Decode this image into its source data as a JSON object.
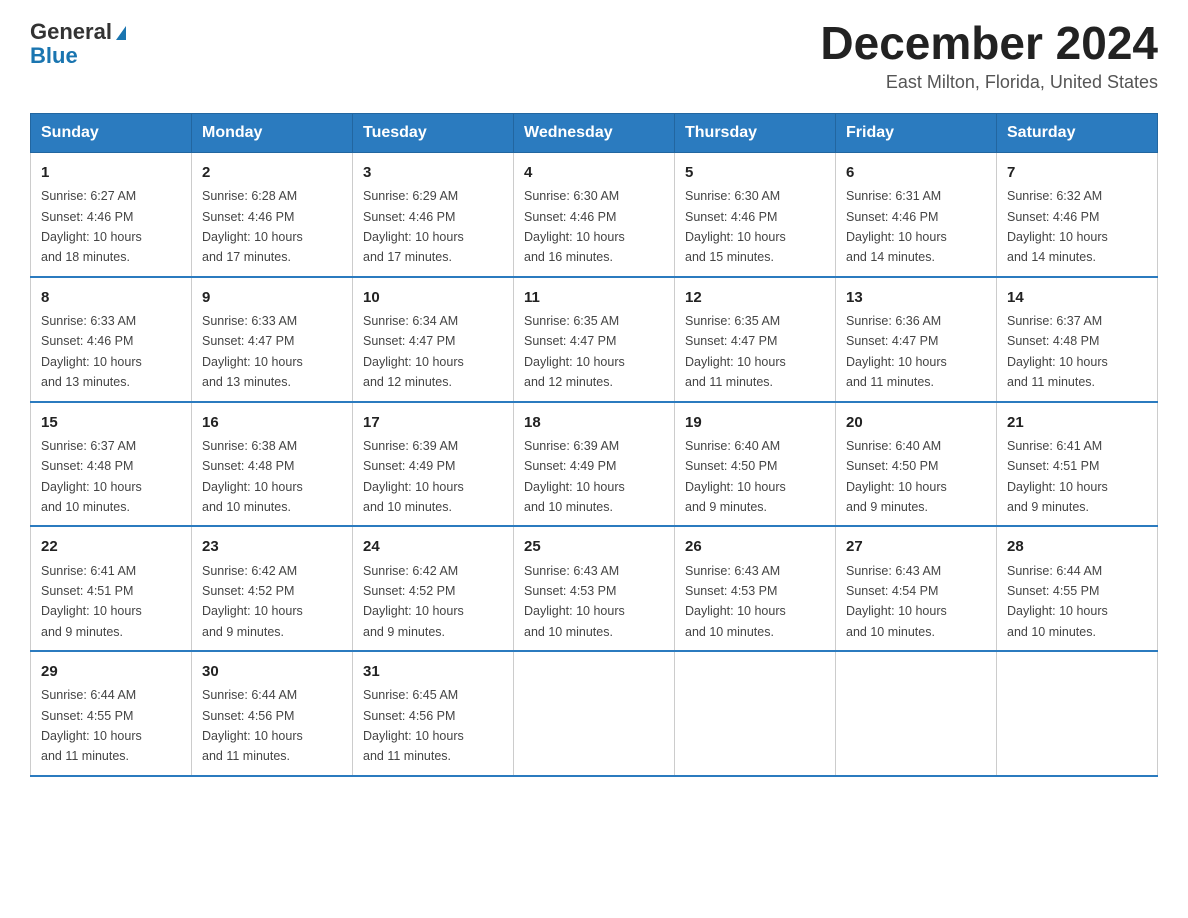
{
  "header": {
    "logo_general": "General",
    "logo_blue": "Blue",
    "month_title": "December 2024",
    "location": "East Milton, Florida, United States"
  },
  "days_of_week": [
    "Sunday",
    "Monday",
    "Tuesday",
    "Wednesday",
    "Thursday",
    "Friday",
    "Saturday"
  ],
  "weeks": [
    [
      {
        "day": "1",
        "sunrise": "6:27 AM",
        "sunset": "4:46 PM",
        "daylight": "10 hours and 18 minutes."
      },
      {
        "day": "2",
        "sunrise": "6:28 AM",
        "sunset": "4:46 PM",
        "daylight": "10 hours and 17 minutes."
      },
      {
        "day": "3",
        "sunrise": "6:29 AM",
        "sunset": "4:46 PM",
        "daylight": "10 hours and 17 minutes."
      },
      {
        "day": "4",
        "sunrise": "6:30 AM",
        "sunset": "4:46 PM",
        "daylight": "10 hours and 16 minutes."
      },
      {
        "day": "5",
        "sunrise": "6:30 AM",
        "sunset": "4:46 PM",
        "daylight": "10 hours and 15 minutes."
      },
      {
        "day": "6",
        "sunrise": "6:31 AM",
        "sunset": "4:46 PM",
        "daylight": "10 hours and 14 minutes."
      },
      {
        "day": "7",
        "sunrise": "6:32 AM",
        "sunset": "4:46 PM",
        "daylight": "10 hours and 14 minutes."
      }
    ],
    [
      {
        "day": "8",
        "sunrise": "6:33 AM",
        "sunset": "4:46 PM",
        "daylight": "10 hours and 13 minutes."
      },
      {
        "day": "9",
        "sunrise": "6:33 AM",
        "sunset": "4:47 PM",
        "daylight": "10 hours and 13 minutes."
      },
      {
        "day": "10",
        "sunrise": "6:34 AM",
        "sunset": "4:47 PM",
        "daylight": "10 hours and 12 minutes."
      },
      {
        "day": "11",
        "sunrise": "6:35 AM",
        "sunset": "4:47 PM",
        "daylight": "10 hours and 12 minutes."
      },
      {
        "day": "12",
        "sunrise": "6:35 AM",
        "sunset": "4:47 PM",
        "daylight": "10 hours and 11 minutes."
      },
      {
        "day": "13",
        "sunrise": "6:36 AM",
        "sunset": "4:47 PM",
        "daylight": "10 hours and 11 minutes."
      },
      {
        "day": "14",
        "sunrise": "6:37 AM",
        "sunset": "4:48 PM",
        "daylight": "10 hours and 11 minutes."
      }
    ],
    [
      {
        "day": "15",
        "sunrise": "6:37 AM",
        "sunset": "4:48 PM",
        "daylight": "10 hours and 10 minutes."
      },
      {
        "day": "16",
        "sunrise": "6:38 AM",
        "sunset": "4:48 PM",
        "daylight": "10 hours and 10 minutes."
      },
      {
        "day": "17",
        "sunrise": "6:39 AM",
        "sunset": "4:49 PM",
        "daylight": "10 hours and 10 minutes."
      },
      {
        "day": "18",
        "sunrise": "6:39 AM",
        "sunset": "4:49 PM",
        "daylight": "10 hours and 10 minutes."
      },
      {
        "day": "19",
        "sunrise": "6:40 AM",
        "sunset": "4:50 PM",
        "daylight": "10 hours and 9 minutes."
      },
      {
        "day": "20",
        "sunrise": "6:40 AM",
        "sunset": "4:50 PM",
        "daylight": "10 hours and 9 minutes."
      },
      {
        "day": "21",
        "sunrise": "6:41 AM",
        "sunset": "4:51 PM",
        "daylight": "10 hours and 9 minutes."
      }
    ],
    [
      {
        "day": "22",
        "sunrise": "6:41 AM",
        "sunset": "4:51 PM",
        "daylight": "10 hours and 9 minutes."
      },
      {
        "day": "23",
        "sunrise": "6:42 AM",
        "sunset": "4:52 PM",
        "daylight": "10 hours and 9 minutes."
      },
      {
        "day": "24",
        "sunrise": "6:42 AM",
        "sunset": "4:52 PM",
        "daylight": "10 hours and 9 minutes."
      },
      {
        "day": "25",
        "sunrise": "6:43 AM",
        "sunset": "4:53 PM",
        "daylight": "10 hours and 10 minutes."
      },
      {
        "day": "26",
        "sunrise": "6:43 AM",
        "sunset": "4:53 PM",
        "daylight": "10 hours and 10 minutes."
      },
      {
        "day": "27",
        "sunrise": "6:43 AM",
        "sunset": "4:54 PM",
        "daylight": "10 hours and 10 minutes."
      },
      {
        "day": "28",
        "sunrise": "6:44 AM",
        "sunset": "4:55 PM",
        "daylight": "10 hours and 10 minutes."
      }
    ],
    [
      {
        "day": "29",
        "sunrise": "6:44 AM",
        "sunset": "4:55 PM",
        "daylight": "10 hours and 11 minutes."
      },
      {
        "day": "30",
        "sunrise": "6:44 AM",
        "sunset": "4:56 PM",
        "daylight": "10 hours and 11 minutes."
      },
      {
        "day": "31",
        "sunrise": "6:45 AM",
        "sunset": "4:56 PM",
        "daylight": "10 hours and 11 minutes."
      },
      null,
      null,
      null,
      null
    ]
  ],
  "labels": {
    "sunrise": "Sunrise:",
    "sunset": "Sunset:",
    "daylight": "Daylight:"
  }
}
